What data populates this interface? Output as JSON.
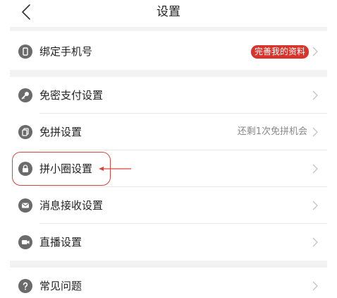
{
  "header": {
    "title": "设置"
  },
  "account_section": {
    "bind_phone": {
      "label": "绑定手机号",
      "badge": "完善我的资料"
    }
  },
  "settings_section": {
    "items": [
      {
        "label": "免密支付设置"
      },
      {
        "label": "免拼设置",
        "hint": "还剩1次免拼机会"
      },
      {
        "label": "拼小圈设置"
      },
      {
        "label": "消息接收设置"
      },
      {
        "label": "直播设置"
      }
    ]
  },
  "help_section": {
    "faq": {
      "label": "常见问题"
    }
  },
  "colors": {
    "accent_red": "#d9342b",
    "icon_gray": "#6b6b6b",
    "section_gap": "#f2f2f2"
  }
}
